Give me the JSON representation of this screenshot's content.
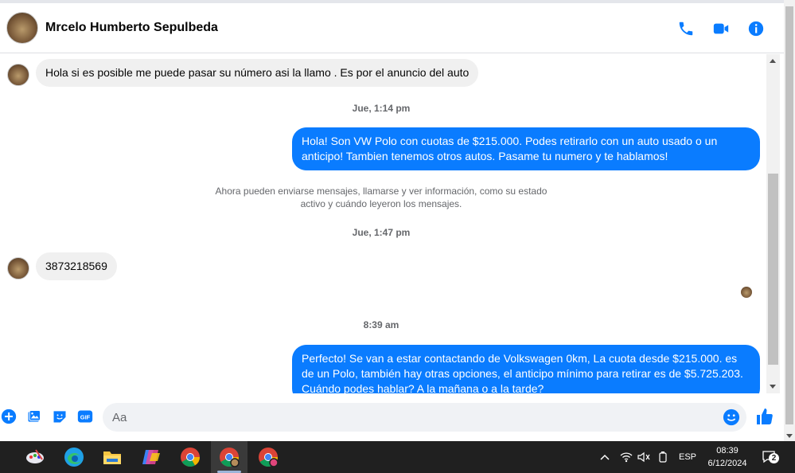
{
  "header": {
    "contact_name": "Mrcelo Humberto Sepulbeda",
    "icons": [
      "phone-icon",
      "video-camera-icon",
      "info-icon"
    ]
  },
  "messages": [
    {
      "type": "incoming",
      "text": "Hola si es posible me puede pasar su número asi la llamo . Es por el anuncio del auto"
    },
    {
      "type": "timestamp",
      "text": "Jue, 1:14 pm"
    },
    {
      "type": "outgoing",
      "text": "Hola! Son VW Polo con cuotas de $215.000. Podes retirarlo con un auto usado o un anticipo! Tambien tenemos otros autos. Pasame tu numero y te hablamos!"
    },
    {
      "type": "system",
      "text_line1": "Ahora pueden enviarse mensajes, llamarse y ver información, como su estado",
      "text_line2": "activo y cuándo leyeron los mensajes."
    },
    {
      "type": "timestamp",
      "text": "Jue, 1:47 pm"
    },
    {
      "type": "incoming",
      "text": "3873218569"
    },
    {
      "type": "timestamp",
      "text": "8:39 am"
    },
    {
      "type": "outgoing",
      "text": "Perfecto!  Se van a estar contactando de Volkswagen 0km, La cuota desde $215.000. es de un Polo, también hay otras opciones, el anticipo mínimo para retirar es de $5.725.203. Cuándo podes hablar? A la mañana o a la tarde?"
    }
  ],
  "composer": {
    "placeholder": "Aa",
    "icons": [
      "plus-icon",
      "image-icon",
      "sticker-icon",
      "gif-icon",
      "emoji-icon",
      "thumbs-up-icon"
    ],
    "gif_label": "GIF"
  },
  "taskbar": {
    "language": "ESP",
    "time": "08:39",
    "date": "6/12/2024",
    "notification_count": "2"
  },
  "colors": {
    "accent": "#0a7cff",
    "incoming_bubble": "#f0f0f0",
    "taskbar": "#202020"
  }
}
